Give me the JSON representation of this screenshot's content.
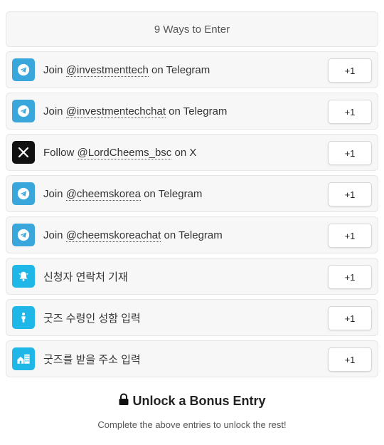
{
  "header": {
    "title": "9 Ways to Enter"
  },
  "entries": [
    {
      "icon": "telegram-icon",
      "prefix": "Join ",
      "handle": "@investmenttech",
      "suffix": " on Telegram",
      "points": "+1"
    },
    {
      "icon": "telegram-icon",
      "prefix": "Join ",
      "handle": "@investmentechchat",
      "suffix": " on Telegram",
      "points": "+1"
    },
    {
      "icon": "x-logo-icon",
      "prefix": "Follow ",
      "handle": "@LordCheems_bsc",
      "suffix": " on X",
      "points": "+1"
    },
    {
      "icon": "telegram-icon",
      "prefix": "Join ",
      "handle": "@cheemskorea",
      "suffix": " on Telegram",
      "points": "+1"
    },
    {
      "icon": "telegram-icon",
      "prefix": "Join ",
      "handle": "@cheemskoreachat",
      "suffix": " on Telegram",
      "points": "+1"
    },
    {
      "icon": "bell-icon",
      "text": "신청자 연락처 기재",
      "points": "+1"
    },
    {
      "icon": "person-icon",
      "text": "굿즈 수령인 성함 입력",
      "points": "+1"
    },
    {
      "icon": "home-building-icon",
      "text": "굿즈를 받을 주소 입력",
      "points": "+1"
    }
  ],
  "bonus": {
    "icon": "lock-icon",
    "title": "Unlock a Bonus Entry",
    "subtitle": "Complete the above entries to unlock the rest!"
  },
  "colors": {
    "telegram": "#3aa7dc",
    "x": "#111111",
    "form": "#1fb7e8"
  }
}
